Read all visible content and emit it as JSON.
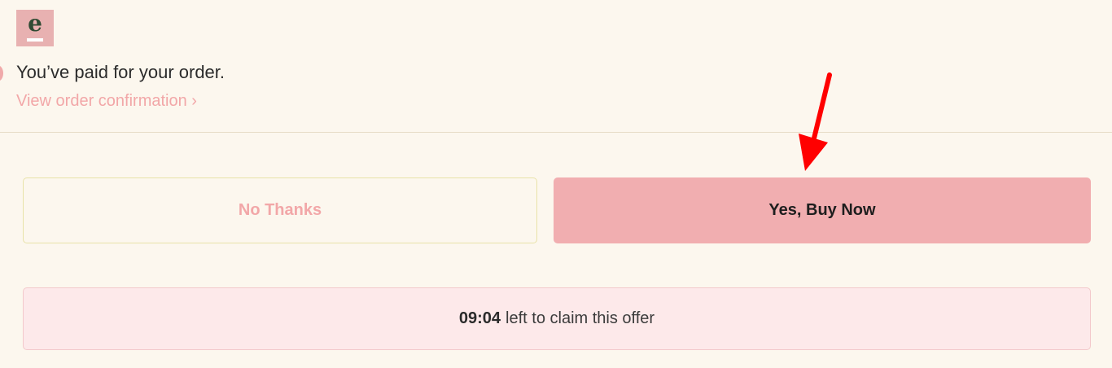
{
  "logo": {
    "letter": "e",
    "icon": "brand-logo-icon"
  },
  "order": {
    "paid_message": "You’ve paid for your order.",
    "confirmation_link": "View order confirmation ›"
  },
  "actions": {
    "decline_label": "No Thanks",
    "accept_label": "Yes, Buy Now"
  },
  "offer": {
    "timer": "09:04",
    "message": "left to claim this offer"
  },
  "annotation": {
    "icon": "red-arrow-icon",
    "color": "#ff0000"
  },
  "colors": {
    "background": "#fcf7ee",
    "accent_pink": "#f1aeb0",
    "link_pink": "#f2a7a8",
    "offer_bg": "#fde9ea"
  }
}
